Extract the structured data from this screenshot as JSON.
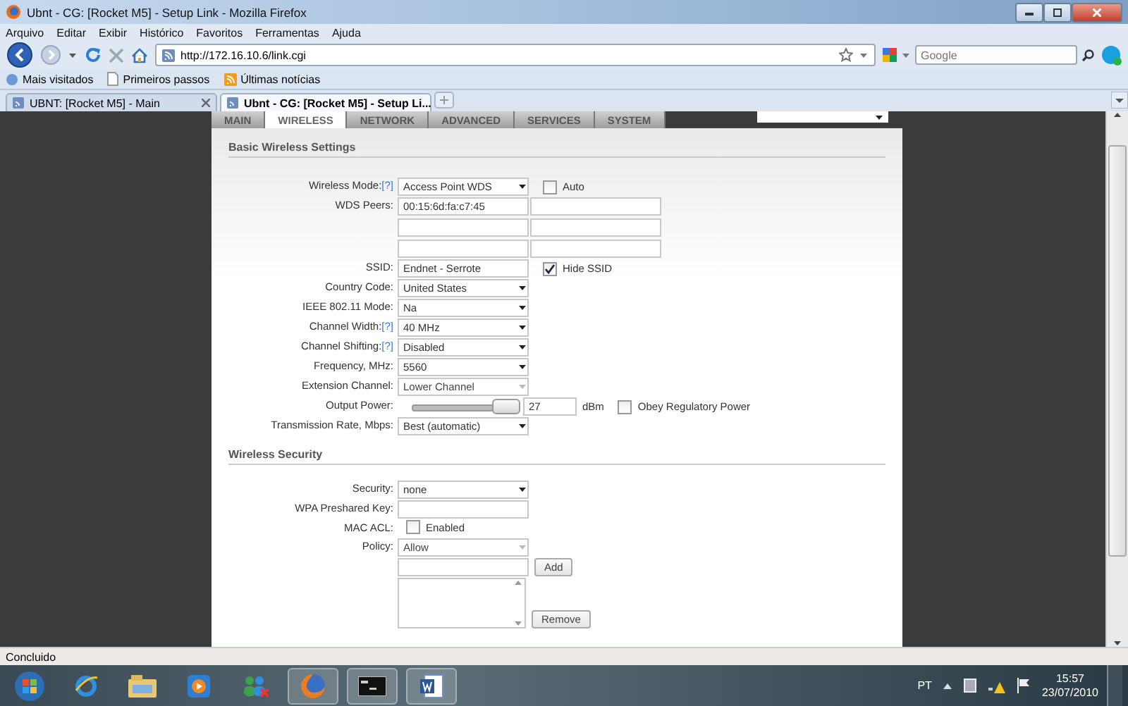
{
  "window": {
    "title": "Ubnt - CG: [Rocket M5] - Setup Link - Mozilla Firefox"
  },
  "menu": [
    "Arquivo",
    "Editar",
    "Exibir",
    "Histórico",
    "Favoritos",
    "Ferramentas",
    "Ajuda"
  ],
  "address_bar": {
    "value": "http://172.16.10.6/link.cgi"
  },
  "search": {
    "placeholder": "Google"
  },
  "bookmarks": [
    "Mais visitados",
    "Primeiros passos",
    "Últimas notícias"
  ],
  "browser_tabs": [
    {
      "label": "UBNT: [Rocket M5] - Main",
      "selected": false
    },
    {
      "label": "Ubnt - CG: [Rocket M5] - Setup Li...",
      "selected": true
    }
  ],
  "page": {
    "nav_tabs": [
      {
        "label": "MAIN",
        "selected": false
      },
      {
        "label": "WIRELESS",
        "selected": true
      },
      {
        "label": "NETWORK",
        "selected": false
      },
      {
        "label": "ADVANCED",
        "selected": false
      },
      {
        "label": "SERVICES",
        "selected": false
      },
      {
        "label": "SYSTEM",
        "selected": false
      }
    ],
    "sections": [
      {
        "title": "Basic Wireless Settings",
        "rows": [
          {
            "kind": "select",
            "label": "Wireless Mode:",
            "help": "[?]",
            "value": "Access Point WDS",
            "disabled": false,
            "checkbox": {
              "label": "Auto",
              "checked": false
            }
          },
          {
            "kind": "peers",
            "label": "WDS Peers:",
            "values": [
              "00:15:6d:fa:c7:45"
            ]
          },
          {
            "kind": "text",
            "label": "SSID:",
            "value": "Endnet - Serrote",
            "checkbox": {
              "label": "Hide SSID",
              "checked": true
            }
          },
          {
            "kind": "select",
            "label": "Country Code:",
            "value": "United States",
            "disabled": false
          },
          {
            "kind": "select",
            "label": "IEEE 802.11 Mode:",
            "value": "Na",
            "disabled": false
          },
          {
            "kind": "select",
            "label": "Channel Width:",
            "help": "[?]",
            "value": "40 MHz",
            "disabled": false
          },
          {
            "kind": "select",
            "label": "Channel Shifting:",
            "help": "[?]",
            "value": "Disabled",
            "disabled": false
          },
          {
            "kind": "select",
            "label": "Frequency, MHz:",
            "value": "5560",
            "disabled": false
          },
          {
            "kind": "select",
            "label": "Extension Channel:",
            "value": "Lower Channel",
            "disabled": true
          },
          {
            "kind": "slider",
            "label": "Output Power:",
            "level": 1,
            "value": "27",
            "unit": "dBm",
            "checkbox": {
              "label": "Obey Regulatory Power",
              "checked": false
            }
          },
          {
            "kind": "select",
            "label": "Transmission Rate, Mbps:",
            "value": "Best (automatic)",
            "disabled": false
          }
        ]
      },
      {
        "title": "Wireless Security",
        "rows": [
          {
            "kind": "select",
            "label": "Security:",
            "value": "none",
            "disabled": false
          },
          {
            "kind": "text",
            "label": "WPA Preshared Key:"
          },
          {
            "kind": "checkbox",
            "label": "MAC ACL:",
            "checkbox": {
              "label": "Enabled",
              "checked": false
            }
          },
          {
            "kind": "select",
            "label": "Policy:",
            "value": "Allow",
            "disabled": true
          },
          {
            "kind": "add",
            "button": "Add"
          },
          {
            "kind": "listbox",
            "button": "Remove"
          }
        ]
      }
    ]
  },
  "status_bar": {
    "text": "Concluido"
  },
  "taskbar": {
    "language": "PT",
    "time": "15:57",
    "date": "23/07/2010"
  }
}
